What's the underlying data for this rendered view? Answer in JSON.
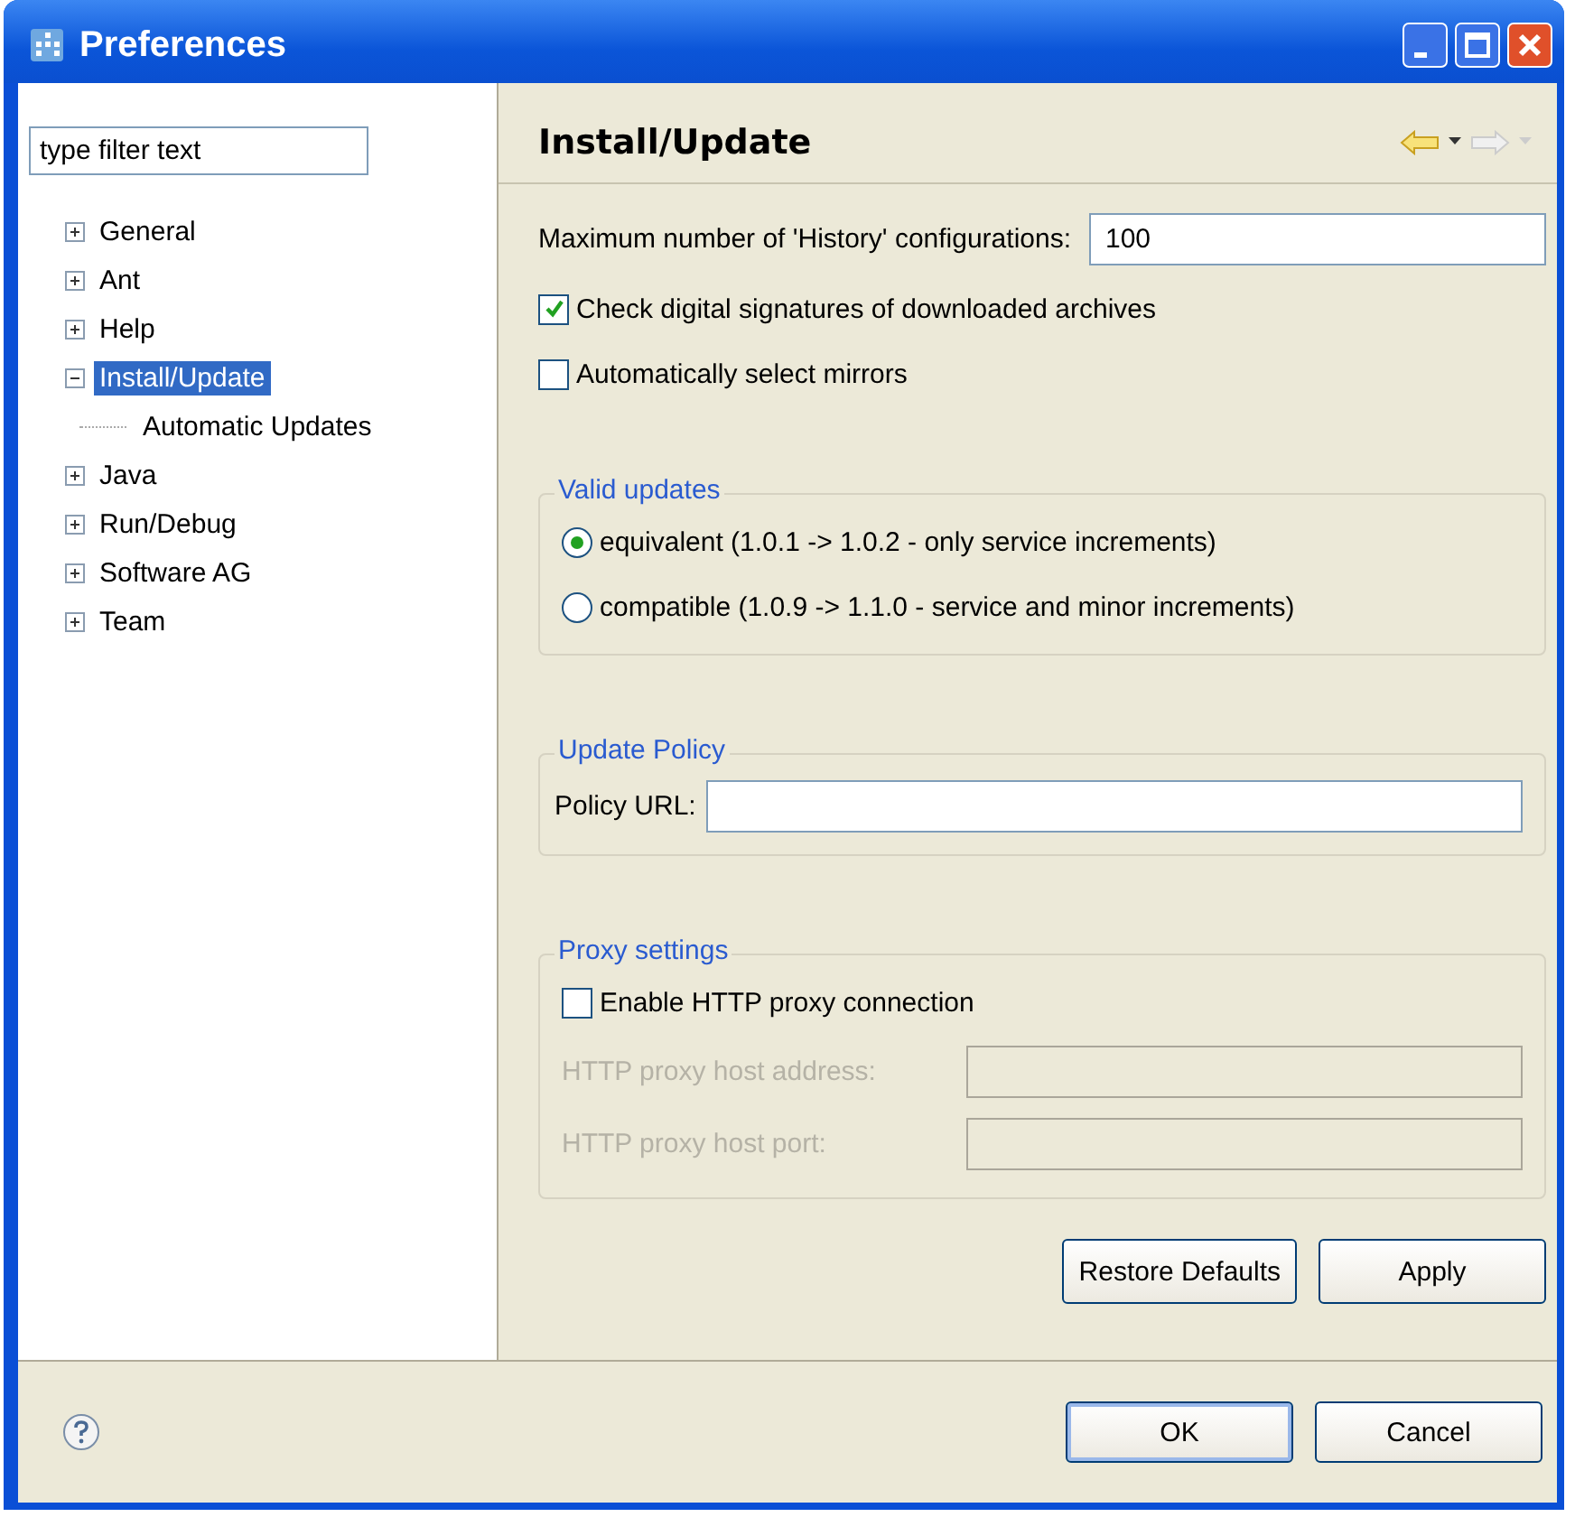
{
  "window": {
    "title": "Preferences"
  },
  "filter": {
    "placeholder": "type filter text"
  },
  "tree": [
    {
      "label": "General",
      "expanded": false,
      "selected": false
    },
    {
      "label": "Ant",
      "expanded": false,
      "selected": false
    },
    {
      "label": "Help",
      "expanded": false,
      "selected": false
    },
    {
      "label": "Install/Update",
      "expanded": true,
      "selected": true,
      "children": [
        {
          "label": "Automatic Updates",
          "selected": false
        }
      ]
    },
    {
      "label": "Java",
      "expanded": false,
      "selected": false
    },
    {
      "label": "Run/Debug",
      "expanded": false,
      "selected": false
    },
    {
      "label": "Software AG",
      "expanded": false,
      "selected": false
    },
    {
      "label": "Team",
      "expanded": false,
      "selected": false
    }
  ],
  "page": {
    "title": "Install/Update",
    "history": {
      "label": "Maximum number of 'History' configurations:",
      "value": "100"
    },
    "checkboxes": [
      {
        "label": "Check digital signatures of downloaded archives",
        "checked": true
      },
      {
        "label": "Automatically select mirrors",
        "checked": false
      }
    ],
    "valid_updates": {
      "title": "Valid updates",
      "options": [
        {
          "label": "equivalent (1.0.1 -> 1.0.2 - only service increments)",
          "selected": true
        },
        {
          "label": "compatible (1.0.9 -> 1.1.0 - service and minor increments)",
          "selected": false
        }
      ]
    },
    "update_policy": {
      "title": "Update Policy",
      "url_label": "Policy URL:"
    },
    "proxy": {
      "title": "Proxy settings",
      "enable": {
        "label": "Enable HTTP proxy connection",
        "checked": false
      },
      "fields": [
        {
          "label": "HTTP proxy host address:",
          "disabled": true
        },
        {
          "label": "HTTP proxy host port:",
          "disabled": true
        }
      ]
    },
    "buttons": [
      "Restore Defaults",
      "Apply"
    ]
  },
  "dialog_buttons": [
    "OK",
    "Cancel"
  ]
}
